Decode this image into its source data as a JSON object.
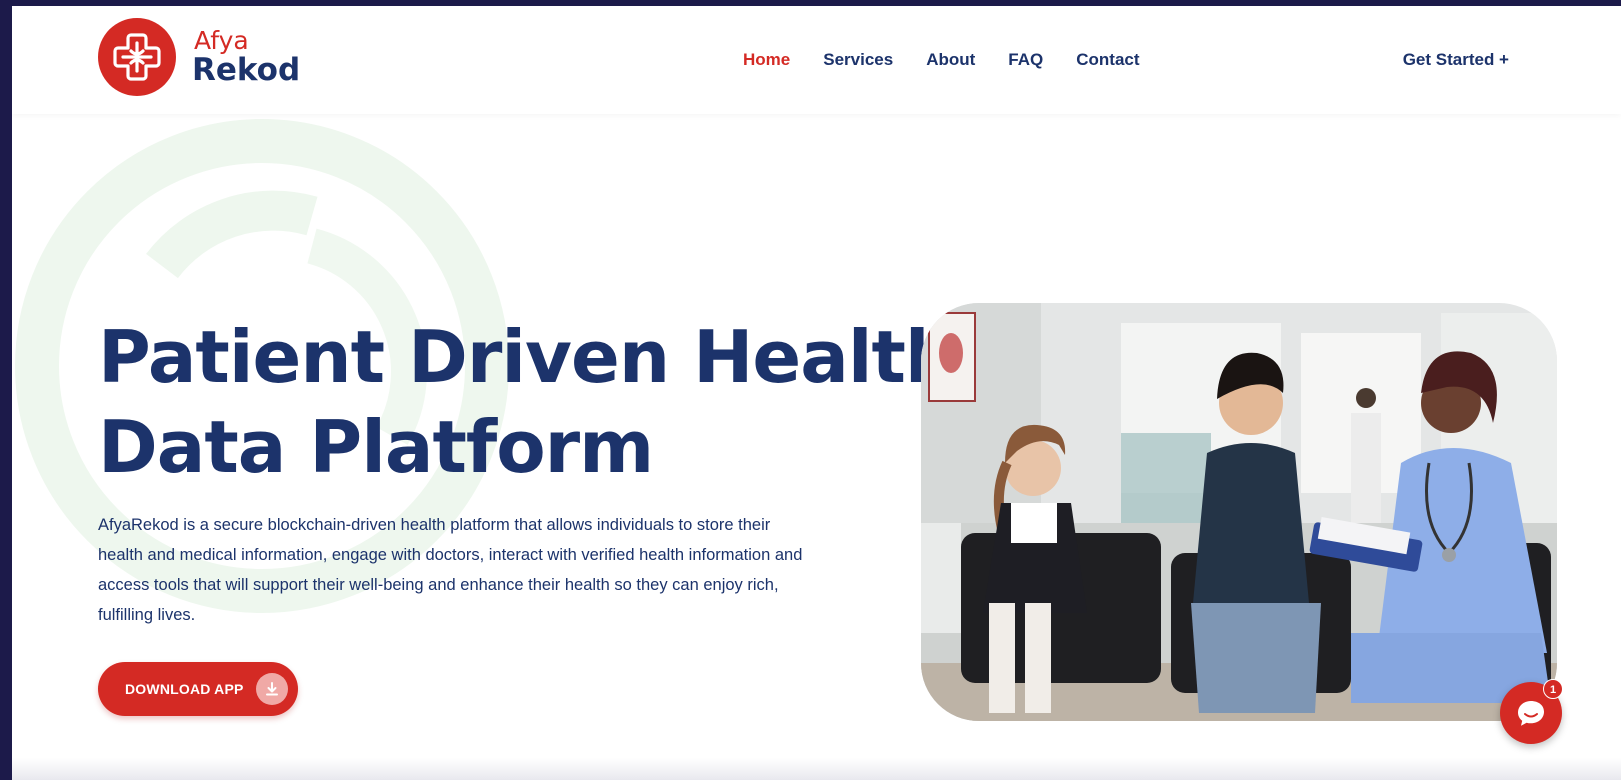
{
  "brand": {
    "name_line1": "Afya",
    "name_line2": "Rekod",
    "primary_color": "#d42a24",
    "navy_color": "#1c336b"
  },
  "nav": {
    "items": [
      {
        "label": "Home",
        "active": true
      },
      {
        "label": "Services",
        "active": false
      },
      {
        "label": "About",
        "active": false
      },
      {
        "label": "FAQ",
        "active": false
      },
      {
        "label": "Contact",
        "active": false
      }
    ],
    "cta": "Get Started +"
  },
  "hero": {
    "title_line1": "Patient Driven Health",
    "title_line2": "Data Platform",
    "description": "AfyaRekod is a secure blockchain-driven health platform that allows individuals to store their health and medical information, engage with doctors, interact with verified health information and access tools that will support their well-being and enhance their health so they can enjoy rich, fulfilling lives.",
    "button_label": "DOWNLOAD APP",
    "button_icon": "download-icon",
    "image_subject": "nurse-with-patients-photo"
  },
  "chat_widget": {
    "icon": "chat-bubble-icon",
    "badge_count": "1"
  }
}
